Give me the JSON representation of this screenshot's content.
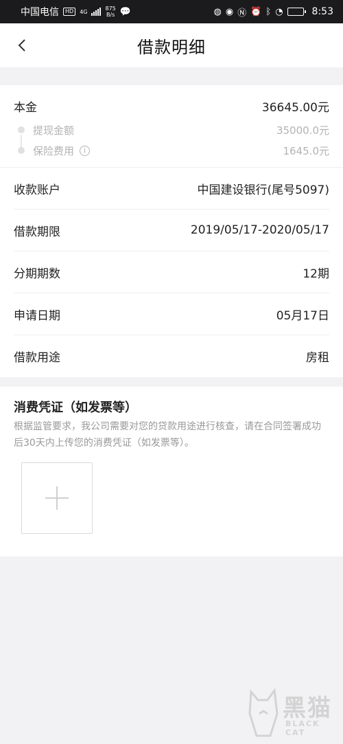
{
  "status_bar": {
    "carrier": "中国电信",
    "hd_badge": "HD",
    "network": "4G",
    "speed_value": "875",
    "speed_unit": "B/s",
    "time": "8:53"
  },
  "header": {
    "title": "借款明细"
  },
  "principal": {
    "label": "本金",
    "value": "36645.00元",
    "items": [
      {
        "label": "提现金额",
        "value": "35000.0元"
      },
      {
        "label": "保险费用",
        "value": "1645.0元"
      }
    ]
  },
  "rows": [
    {
      "label": "收款账户",
      "value": "中国建设银行(尾号5097)"
    },
    {
      "label": "借款期限",
      "value": "2019/05/17-2020/05/17"
    },
    {
      "label": "分期期数",
      "value": "12期"
    },
    {
      "label": "申请日期",
      "value": "05月17日"
    },
    {
      "label": "借款用途",
      "value": "房租"
    }
  ],
  "voucher": {
    "title": "消费凭证（如发票等）",
    "description": "根据监管要求，我公司需要对您的贷款用途进行核查，请在合同签署成功后30天内上传您的消费凭证（如发票等）。"
  },
  "watermark": {
    "name": "黑猫",
    "sub": "BLACK CAT"
  },
  "icons": {
    "back": "chevron-left-icon",
    "info": "info-icon",
    "upload": "plus-icon"
  }
}
